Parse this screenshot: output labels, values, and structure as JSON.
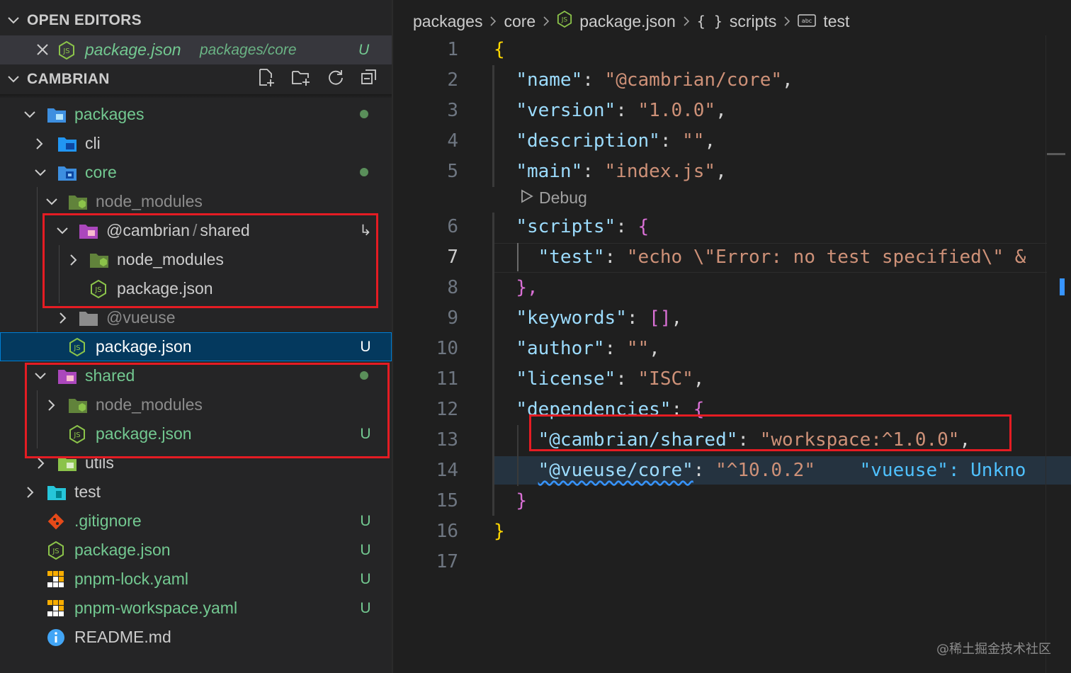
{
  "open_editors": {
    "title": "OPEN EDITORS",
    "file": {
      "name": "package.json",
      "path": "packages/core",
      "status": "U"
    }
  },
  "explorer": {
    "title": "CAMBRIAN",
    "items": [
      {
        "label": "packages",
        "status": ""
      },
      {
        "label": "cli",
        "status": ""
      },
      {
        "label": "core",
        "status": ""
      },
      {
        "label": "node_modules",
        "status": ""
      },
      {
        "label": "@cambrian",
        "sep": "/",
        "label2": "shared",
        "status": "↳"
      },
      {
        "label": "node_modules",
        "status": ""
      },
      {
        "label": "package.json",
        "status": ""
      },
      {
        "label": "@vueuse",
        "status": ""
      },
      {
        "label": "package.json",
        "status": "U"
      },
      {
        "label": "shared",
        "status": ""
      },
      {
        "label": "node_modules",
        "status": ""
      },
      {
        "label": "package.json",
        "status": "U"
      },
      {
        "label": "utils",
        "status": ""
      },
      {
        "label": "test",
        "status": ""
      },
      {
        "label": ".gitignore",
        "status": "U"
      },
      {
        "label": "package.json",
        "status": "U"
      },
      {
        "label": "pnpm-lock.yaml",
        "status": "U"
      },
      {
        "label": "pnpm-workspace.yaml",
        "status": "U"
      },
      {
        "label": "README.md",
        "status": ""
      }
    ]
  },
  "breadcrumb": {
    "items": [
      "packages",
      "core",
      "package.json",
      "{ }",
      "scripts",
      "test"
    ]
  },
  "editor": {
    "line_numbers": [
      "1",
      "2",
      "3",
      "4",
      "5",
      "6",
      "7",
      "8",
      "9",
      "10",
      "11",
      "12",
      "13",
      "14",
      "15",
      "16",
      "17"
    ],
    "codelens": "Debug",
    "lines": {
      "l1": "{",
      "l2_key": "\"name\"",
      "l2_val": "\"@cambrian/core\"",
      "l3_key": "\"version\"",
      "l3_val": "\"1.0.0\"",
      "l4_key": "\"description\"",
      "l4_val": "\"\"",
      "l5_key": "\"main\"",
      "l5_val": "\"index.js\"",
      "l6_key": "\"scripts\"",
      "l7_key": "\"test\"",
      "l7_val": "\"echo \\\"Error: no test specified\\\" &",
      "l8": "},",
      "l9_key": "\"keywords\"",
      "l9_val": "[]",
      "l10_key": "\"author\"",
      "l10_val": "\"\"",
      "l11_key": "\"license\"",
      "l11_val": "\"ISC\"",
      "l12_key": "\"dependencies\"",
      "l13_key": "\"@cambrian/shared\"",
      "l13_val": "\"workspace:^1.0.0\"",
      "l14_key": "\"@vueuse/core\"",
      "l14_val": "\"^10.0.2\"",
      "l14_hint": "\"vueuse\": Unkno",
      "l15": "}",
      "l16": "}"
    }
  },
  "watermark": "@稀土掘金技术社区",
  "colors": {
    "untracked": "#73c991",
    "selection": "#04395e",
    "red_box": "#e51c23",
    "json_icon": "#8bc34a"
  }
}
